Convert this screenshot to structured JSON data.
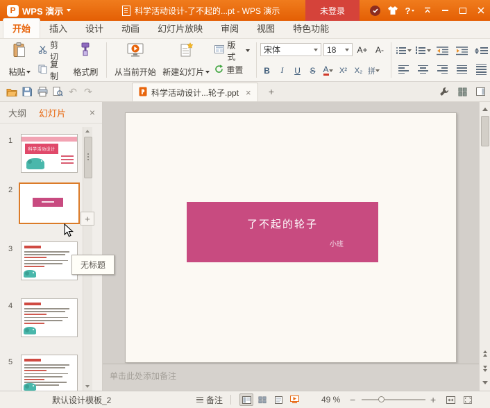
{
  "titlebar": {
    "app_name": "WPS 演示",
    "document_title": "科学活动设计-了不起的...pt - WPS 演示",
    "login_label": "未登录"
  },
  "icons": {
    "logo_glyph": "P",
    "help_glyph": "?",
    "undo_glyph": "↶",
    "redo_glyph": "↷"
  },
  "ribbon_tabs": [
    {
      "label": "开始",
      "active": true
    },
    {
      "label": "插入",
      "active": false
    },
    {
      "label": "设计",
      "active": false
    },
    {
      "label": "动画",
      "active": false
    },
    {
      "label": "幻灯片放映",
      "active": false
    },
    {
      "label": "审阅",
      "active": false
    },
    {
      "label": "视图",
      "active": false
    },
    {
      "label": "特色功能",
      "active": false
    }
  ],
  "ribbon": {
    "paste_label": "粘贴",
    "cut_label": "剪切",
    "copy_label": "复制",
    "format_painter_label": "格式刷",
    "from_current_label": "从当前开始",
    "new_slide_label": "新建幻灯片",
    "layout_label": "版式",
    "reset_label": "重置",
    "font_name": "宋体",
    "font_size": "18",
    "font_increase_label": "A+",
    "font_decrease_label": "A-",
    "bold_label": "B",
    "italic_label": "I",
    "underline_label": "U",
    "strikethrough_label": "S",
    "font_color_label": "A",
    "superscript_label": "X²",
    "subscript_label": "X₂",
    "phonetic_label": "拼"
  },
  "document_tabs": {
    "active_label": "科学活动设计...轮子.ppt",
    "close_glyph": "×",
    "new_tab_glyph": "+"
  },
  "sidebar": {
    "outline_tab": "大纲",
    "slides_tab": "幻灯片",
    "close_glyph": "×",
    "add_slide_glyph": "+",
    "tooltip": "无标题",
    "slides": [
      {
        "number": "1",
        "title": "科学活动设计"
      },
      {
        "number": "2"
      },
      {
        "number": "3"
      },
      {
        "number": "4"
      },
      {
        "number": "5"
      }
    ]
  },
  "slide": {
    "title": "了不起的轮子",
    "subtitle": "小班"
  },
  "notes": {
    "placeholder": "单击此处添加备注"
  },
  "statusbar": {
    "template_name": "默认设计模板_2",
    "notes_label": "备注",
    "zoom_value": "49 %",
    "zoom_out_glyph": "−",
    "zoom_in_glyph": "+"
  },
  "colors": {
    "titlebar_orange": "#e8680f",
    "login_red": "#d5433a",
    "accent_pink": "#c84b80",
    "selection_orange": "#db7b28",
    "thumbnail_teal": "#49b7ab"
  }
}
